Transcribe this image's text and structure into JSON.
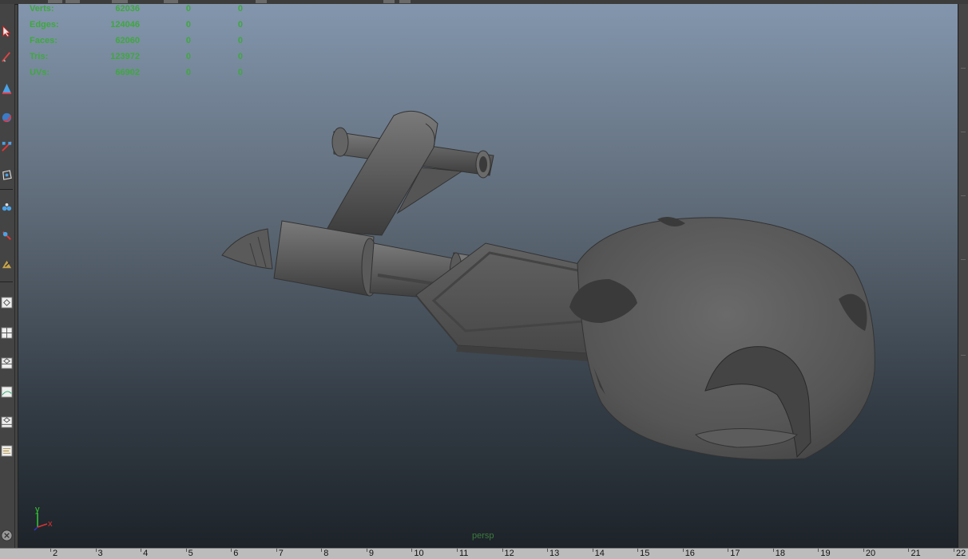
{
  "hud": {
    "rows": [
      {
        "label": "Verts:",
        "v1": "62036",
        "v2": "0",
        "v3": "0"
      },
      {
        "label": "Edges:",
        "v1": "124046",
        "v2": "0",
        "v3": "0"
      },
      {
        "label": "Faces:",
        "v1": "62060",
        "v2": "0",
        "v3": "0"
      },
      {
        "label": "Tris:",
        "v1": "123972",
        "v2": "0",
        "v3": "0"
      },
      {
        "label": "UVs:",
        "v1": "66902",
        "v2": "0",
        "v3": "0"
      }
    ]
  },
  "viewport": {
    "camera": "persp",
    "axis_labels": {
      "y": "y",
      "x": "x"
    }
  },
  "timeline": {
    "ticks": [
      "2",
      "3",
      "4",
      "5",
      "6",
      "7",
      "8",
      "9",
      "10",
      "11",
      "12",
      "13",
      "14",
      "15",
      "16",
      "17",
      "18",
      "19",
      "20",
      "21",
      "22"
    ]
  },
  "toolbox": {
    "tools": [
      "select-tool-icon",
      "lasso-tool-icon",
      "move-tool-icon",
      "rotate-tool-icon",
      "scale-tool-icon",
      "manipulator-tool-icon",
      "soft-mod-icon",
      "show-manipulator-icon",
      "last-tool-icon",
      "single-pane-layout-icon",
      "four-pane-layout-icon",
      "two-pane-layout-icon",
      "graph-layout-icon",
      "outliner-layout-icon",
      "hypershade-layout-icon",
      "render-icon"
    ]
  },
  "colors": {
    "hud_text": "#3ea83e",
    "camera_label": "#3d7a3d",
    "viewport_top": "#8396ad",
    "viewport_bottom": "#1d2329",
    "model_gray": "#5f5f5f"
  }
}
